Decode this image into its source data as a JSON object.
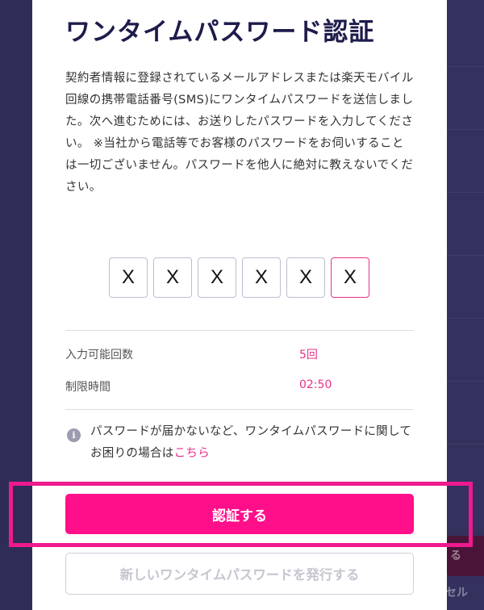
{
  "modal": {
    "title": "ワンタイムパスワード認証",
    "description": "契約者情報に登録されているメールアドレスまたは楽天モバイル回線の携帯電話番号(SMS)にワンタイムパスワードを送信しました。次へ進むためには、お送りしたパスワードを入力してください。 ※当社から電話等でお客様のパスワードをお伺いすることは一切ございません。パスワードを他人に絶対に教えないでください。",
    "otp_digits": [
      "X",
      "X",
      "X",
      "X",
      "X",
      "X"
    ],
    "info": {
      "attempts_label": "入力可能回数",
      "attempts_value": "5回",
      "time_label": "制限時間",
      "time_value": "02:50"
    },
    "notice": {
      "icon": "info-icon",
      "icon_glyph": "i",
      "text": "パスワードが届かないなど、ワンタイムパスワードに関してお困りの場合は",
      "link_text": "こちら"
    },
    "primary_button_label": "認証する",
    "secondary_button_label": "新しいワンタイムパスワードを発行する"
  },
  "background": {
    "right_button_fragment": "る",
    "right_text_fragment": "セル"
  },
  "colors": {
    "accent": "#ff0f8a",
    "title": "#1d1c4b",
    "overlay": "#2e2b5a"
  }
}
